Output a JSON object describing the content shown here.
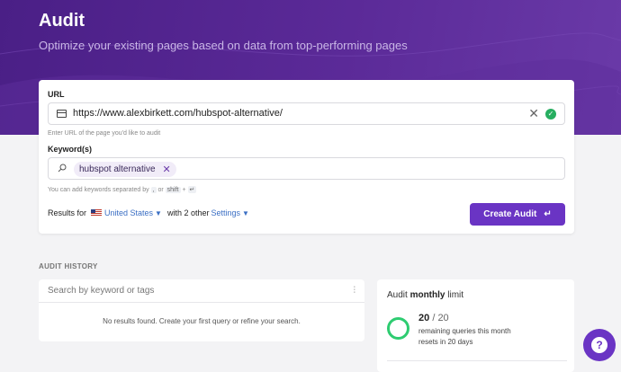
{
  "hero": {
    "title": "Audit",
    "subtitle": "Optimize your existing pages based on data from top-performing pages"
  },
  "form": {
    "url_label": "URL",
    "url_value": "https://www.alexbirkett.com/hubspot-alternative/",
    "url_hint": "Enter URL of the page you'd like to audit",
    "keywords_label": "Keyword(s)",
    "keyword_chip": "hubspot alternative",
    "keywords_hint_prefix": "You can add keywords separated by",
    "keywords_hint_comma": ",",
    "keywords_hint_or": "or",
    "keywords_hint_shift": "shift",
    "keywords_hint_plus": "+",
    "keywords_hint_enter": "↵",
    "results_for": "Results for",
    "country": "United States",
    "with_other": "with 2 other",
    "settings": "Settings",
    "create_button": "Create Audit",
    "create_icon": "↵"
  },
  "history": {
    "section_title": "AUDIT HISTORY",
    "search_placeholder": "Search by keyword or tags",
    "empty_message": "No results found. Create your first query or refine your search."
  },
  "limit": {
    "title_prefix": "Audit",
    "title_bold": "monthly",
    "title_suffix": "limit",
    "used": "20",
    "separator": "/",
    "total": "20",
    "remaining_text": "remaining queries this month",
    "reset_text": "resets in 20 days"
  },
  "help": {
    "icon_text": "?"
  },
  "colors": {
    "brand": "#6a34c4",
    "hero": "#4a1f86",
    "success": "#27ae60",
    "link": "#3b6fc4"
  },
  "icons": [
    "browser-icon",
    "close-icon",
    "check-icon",
    "search-icon",
    "flag-icon",
    "chevron-down-icon",
    "enter-icon",
    "filter-icon",
    "help-icon"
  ]
}
